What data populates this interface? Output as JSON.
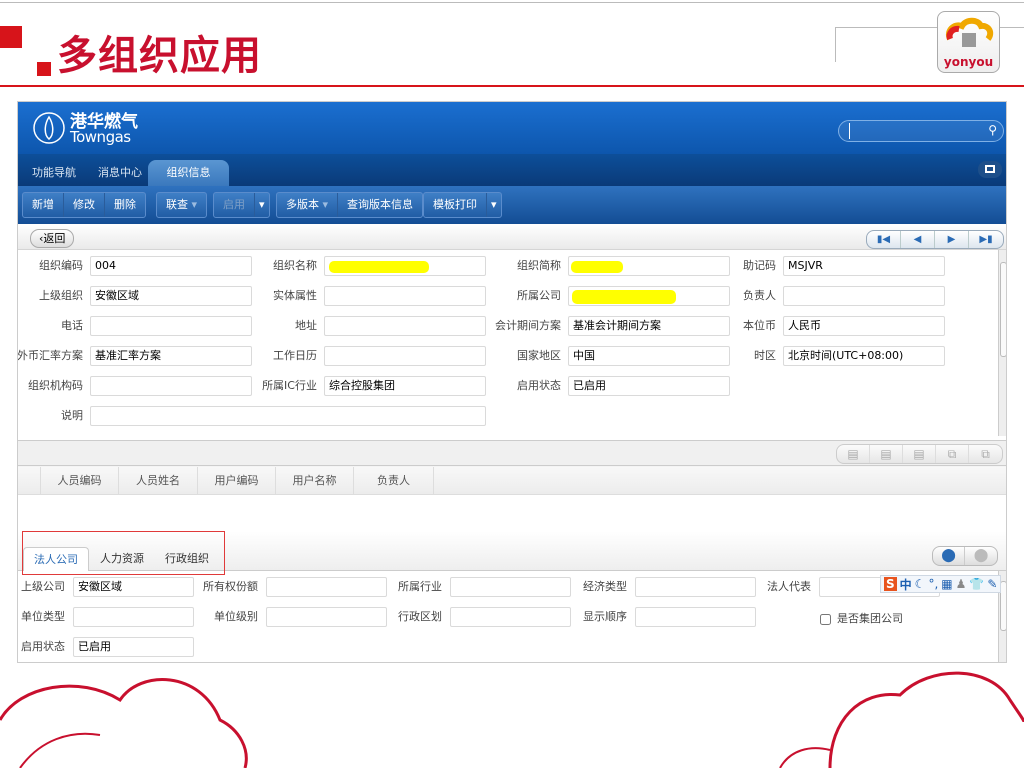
{
  "slide": {
    "title": "多组织应用",
    "logo_text": "yonyou",
    "accent_color": "#c8102e"
  },
  "app": {
    "brand_cn": "港华燃气",
    "brand_en": "Towngas",
    "search_placeholder": "",
    "tabs": [
      {
        "label": "功能导航",
        "active": false
      },
      {
        "label": "消息中心",
        "active": false
      },
      {
        "label": "组织信息",
        "active": true
      }
    ],
    "toolbar": {
      "add": "新增",
      "edit": "修改",
      "delete": "删除",
      "link_query": "联查",
      "enable": "启用",
      "multi_version": "多版本",
      "query_version": "查询版本信息",
      "template_print": "模板打印"
    },
    "back_label": "返回",
    "form": {
      "org_code": {
        "label": "组织编码",
        "value": "004"
      },
      "org_name": {
        "label": "组织名称",
        "value": ""
      },
      "org_short": {
        "label": "组织简称",
        "value": ""
      },
      "mnemonic": {
        "label": "助记码",
        "value": "MSJVR"
      },
      "parent_org": {
        "label": "上级组织",
        "value": "安徽区域"
      },
      "entity_attr": {
        "label": "实体属性",
        "value": ""
      },
      "company": {
        "label": "所属公司",
        "value": ""
      },
      "owner": {
        "label": "负责人",
        "value": ""
      },
      "phone": {
        "label": "电话",
        "value": ""
      },
      "address": {
        "label": "地址",
        "value": ""
      },
      "acct_period": {
        "label": "会计期间方案",
        "value": "基准会计期间方案"
      },
      "currency": {
        "label": "本位币",
        "value": "人民币"
      },
      "fx_scheme": {
        "label": "外币汇率方案",
        "value": "基准汇率方案"
      },
      "work_calendar": {
        "label": "工作日历",
        "value": ""
      },
      "country": {
        "label": "国家地区",
        "value": "中国"
      },
      "timezone": {
        "label": "时区",
        "value": "北京时间(UTC+08:00)"
      },
      "org_inst_code": {
        "label": "组织机构码",
        "value": ""
      },
      "industry": {
        "label": "所属IC行业",
        "value": "综合控股集团"
      },
      "status": {
        "label": "启用状态",
        "value": "已启用"
      },
      "description": {
        "label": "说明",
        "value": ""
      }
    },
    "table_headers": [
      "人员编码",
      "人员姓名",
      "用户编码",
      "用户名称",
      "负责人"
    ],
    "bottom_tabs": [
      {
        "label": "法人公司",
        "active": true
      },
      {
        "label": "人力资源",
        "active": false
      },
      {
        "label": "行政组织",
        "active": false
      }
    ],
    "form2": {
      "parent_company": {
        "label": "上级公司",
        "value": "安徽区域"
      },
      "ownership": {
        "label": "所有权份额",
        "value": ""
      },
      "industry": {
        "label": "所属行业",
        "value": ""
      },
      "econ_type": {
        "label": "经济类型",
        "value": ""
      },
      "legal_rep": {
        "label": "法人代表",
        "value": ""
      },
      "unit_type": {
        "label": "单位类型",
        "value": ""
      },
      "unit_level": {
        "label": "单位级别",
        "value": ""
      },
      "admin_region": {
        "label": "行政区划",
        "value": ""
      },
      "display_order": {
        "label": "显示顺序",
        "value": ""
      },
      "is_group": {
        "label": "是否集团公司",
        "checked": false
      },
      "status": {
        "label": "启用状态",
        "value": "已启用"
      }
    },
    "ime": {
      "logo": "S",
      "mode": "中"
    }
  }
}
